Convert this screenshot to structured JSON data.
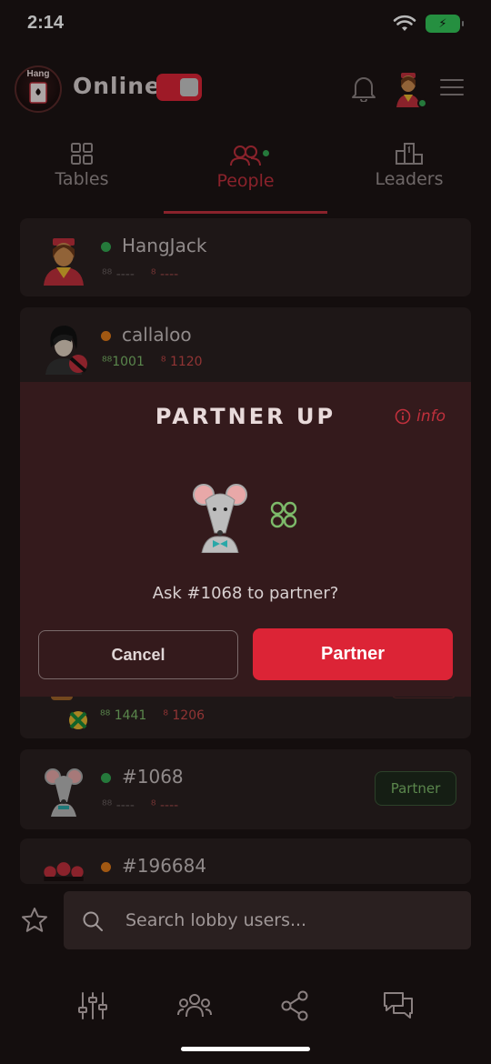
{
  "status_bar": {
    "time": "2:14"
  },
  "header": {
    "logo_text": "Hang",
    "mode_label": "Online"
  },
  "tabs": [
    {
      "label": "Tables",
      "active": false
    },
    {
      "label": "People",
      "active": true
    },
    {
      "label": "Leaders",
      "active": false
    }
  ],
  "people": [
    {
      "name": "HangJack",
      "status": "online",
      "partner_games": "----",
      "rank": "----"
    },
    {
      "name": "callaloo",
      "status": "away",
      "partner_games": "1001",
      "rank": "1120"
    },
    {
      "name": "",
      "status": "",
      "partner_games": "1441",
      "rank": "1206"
    },
    {
      "name": "#1068",
      "status": "online",
      "partner_games": "----",
      "rank": "----",
      "action": "Partner"
    },
    {
      "name": "#196684",
      "status": "away"
    }
  ],
  "modal": {
    "title": "PARTNER UP",
    "info_label": "info",
    "question": "Ask #1068 to partner?",
    "cancel_label": "Cancel",
    "confirm_label": "Partner"
  },
  "search": {
    "placeholder": "Search lobby users..."
  },
  "colors": {
    "accent": "#dc2436",
    "online": "#34a853",
    "away": "#e07a1a",
    "stat_green": "#7dba6a"
  }
}
